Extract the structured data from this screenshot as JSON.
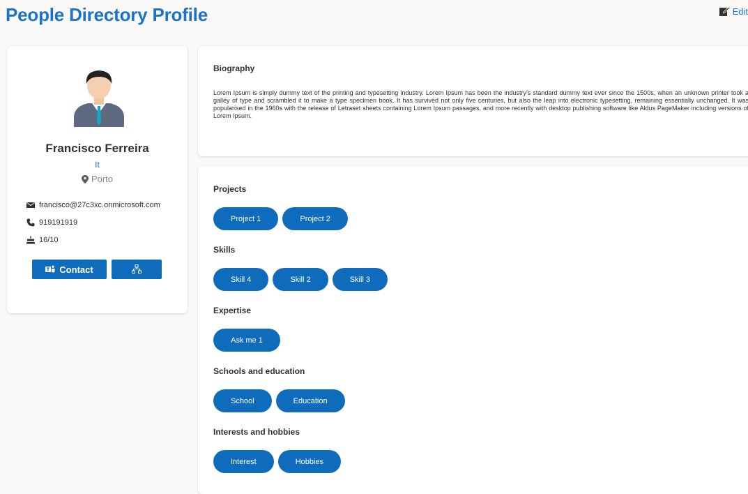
{
  "header": {
    "title": "People Directory Profile",
    "edit_label": "Edit"
  },
  "profile": {
    "name": "Francisco Ferreira",
    "department": "It",
    "location": "Porto",
    "email": "francisco@27c3xc.onmicrosoft.com",
    "phone": "919191919",
    "birthday": "16/10",
    "contact_label": "Contact"
  },
  "biography": {
    "title": "Biography",
    "text": "Lorem Ipsum is simply dummy text of the printing and typesetting industry. Lorem Ipsum has been the industry's standard dummy text ever since the 1500s, when an unknown printer took a galley of type and scrambled it to make a type specimen book. It has survived not only five centuries, but also the leap into electronic typesetting, remaining essentially unchanged. It was popularised in the 1960s with the release of Letraset sheets containing Lorem Ipsum passages, and more recently with desktop publishing software like Aldus PageMaker including versions of Lorem Ipsum."
  },
  "sections": [
    {
      "title": "Projects",
      "items": [
        "Project 1",
        "Project 2"
      ]
    },
    {
      "title": "Skills",
      "items": [
        "Skill 4",
        "Skill 2",
        "Skill 3"
      ]
    },
    {
      "title": "Expertise",
      "items": [
        "Ask me 1"
      ]
    },
    {
      "title": "Schools and education",
      "items": [
        "School",
        "Education"
      ]
    },
    {
      "title": "Interests and hobbies",
      "items": [
        "Interest",
        "Hobbies"
      ]
    }
  ],
  "colors": {
    "accent": "#0f6cbd",
    "title": "#1a73c9"
  }
}
